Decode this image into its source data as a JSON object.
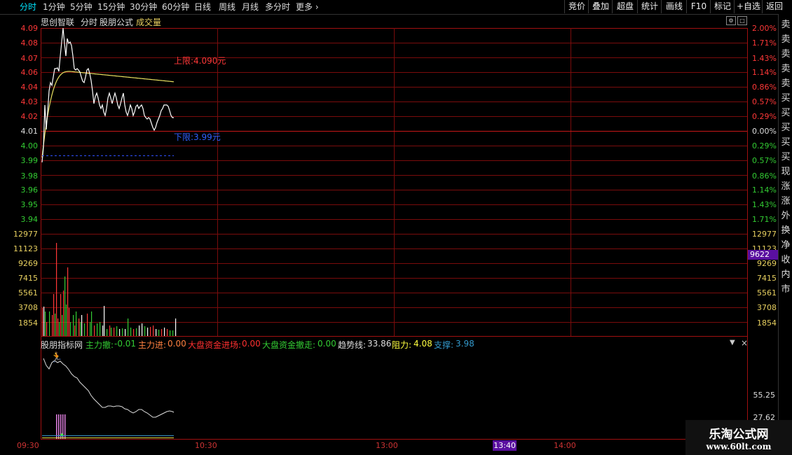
{
  "periods": [
    "分时",
    "1分钟",
    "5分钟",
    "15分钟",
    "30分钟",
    "60分钟",
    "日线",
    "周线",
    "月线",
    "多分时"
  ],
  "more": "更多",
  "right_buttons": [
    "竞价",
    "叠加",
    "超盘",
    "统计",
    "画线",
    "F10",
    "标记",
    "+自选",
    "返回"
  ],
  "header": {
    "stock": "思创智联",
    "mode": "分时",
    "formula": "股朋公式",
    "volume": "成交量"
  },
  "upper_limit": "上限:4.090元",
  "lower_limit": "下限:3.99元",
  "price_ticks": [
    "4.09",
    "4.08",
    "4.07",
    "4.06",
    "4.04",
    "4.03",
    "4.02",
    "4.01",
    "4.00",
    "3.99",
    "3.98",
    "3.96",
    "3.95",
    "3.94"
  ],
  "pct_ticks": [
    "2.00%",
    "1.71%",
    "1.43%",
    "1.14%",
    "0.86%",
    "0.57%",
    "0.29%",
    "0.00%",
    "0.29%",
    "0.57%",
    "0.86%",
    "1.14%",
    "1.43%",
    "1.71%"
  ],
  "vol_ticks": [
    "12977",
    "11123",
    "9269",
    "7415",
    "5561",
    "3708",
    "1854"
  ],
  "vol_ticks_right": [
    "12977",
    "11123",
    "9269",
    "7415",
    "5561",
    "3708",
    "1854"
  ],
  "cursor_value": "9622",
  "indicator": {
    "name": "股朋指标网",
    "items": [
      {
        "label": "主力撤:",
        "value": "-0.01",
        "color": "#33cc33"
      },
      {
        "label": "主力进:",
        "value": "0.00",
        "color": "#ff8040"
      },
      {
        "label": "大盘资金进场:",
        "value": "0.00",
        "color": "#ff3030"
      },
      {
        "label": "大盘资金撤走:",
        "value": "0.00",
        "color": "#33cc33"
      },
      {
        "label": "趋势线:",
        "value": "33.86",
        "color": "#dddddd"
      },
      {
        "label": "阻力:",
        "value": "4.08",
        "color": "#ffff40"
      },
      {
        "label": "支撑:",
        "value": "3.98",
        "color": "#3399cc"
      }
    ],
    "right_ticks": [
      "55.25",
      "27.62"
    ]
  },
  "time_labels": [
    "09:30",
    "10:30",
    "13:00",
    "14:00"
  ],
  "cursor_time": "13:40",
  "right_strip_chars": [
    "卖",
    "卖",
    "卖",
    "卖",
    "卖",
    "买",
    "买",
    "买",
    "买",
    "买",
    "现",
    "涨",
    "涨",
    "外",
    "换",
    "净",
    "收",
    "内",
    "市"
  ],
  "watermark": {
    "title": "乐淘公式网",
    "url": "www.60lt.com"
  }
}
